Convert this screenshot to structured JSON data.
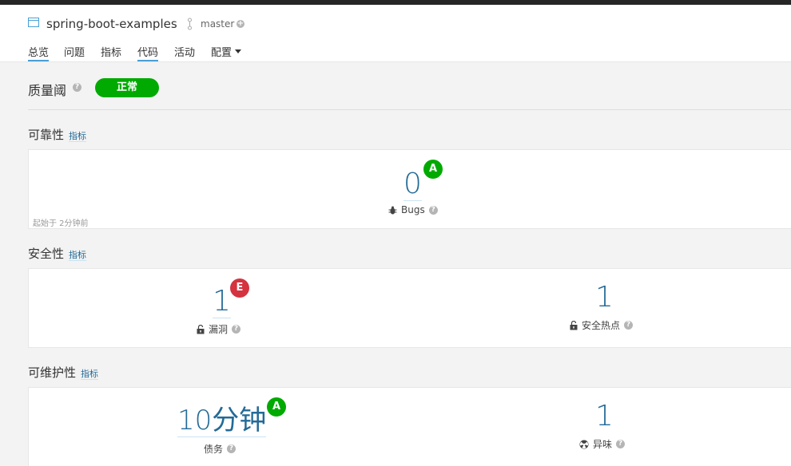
{
  "header": {
    "project_icon": "project-icon",
    "project_name": "spring-boot-examples",
    "branch_icon": "branch-icon",
    "branch_name": "master",
    "add_branch_icon": "plus-circle-icon"
  },
  "nav": {
    "items": [
      {
        "label": "总览",
        "active": true
      },
      {
        "label": "问题",
        "active": false
      },
      {
        "label": "指标",
        "active": false
      },
      {
        "label": "代码",
        "active": true
      },
      {
        "label": "活动",
        "active": false
      },
      {
        "label": "配置",
        "active": false
      }
    ]
  },
  "quality_gate": {
    "label": "质量阈",
    "status": "正常",
    "status_color": "#00aa00"
  },
  "sections": {
    "reliability": {
      "title": "可靠性",
      "link": "指标",
      "value": "0",
      "grade": "A",
      "metric_label": "Bugs",
      "metric_icon": "bug-icon",
      "since": "起始于 2分钟前"
    },
    "security": {
      "title": "安全性",
      "link": "指标",
      "vulnerabilities": {
        "value": "1",
        "grade": "E",
        "label": "漏洞",
        "icon": "lock-open-icon"
      },
      "hotspots": {
        "value": "1",
        "label": "安全热点",
        "icon": "lock-open-icon"
      }
    },
    "maintainability": {
      "title": "可维护性",
      "link": "指标",
      "debt": {
        "value": "10分钟",
        "grade": "A",
        "label": "债务"
      },
      "smells": {
        "value": "1",
        "label": "异味",
        "icon": "radiation-icon"
      }
    }
  },
  "colors": {
    "grade_a": "#00aa00",
    "grade_e": "#d4333f",
    "link": "#236a97"
  }
}
